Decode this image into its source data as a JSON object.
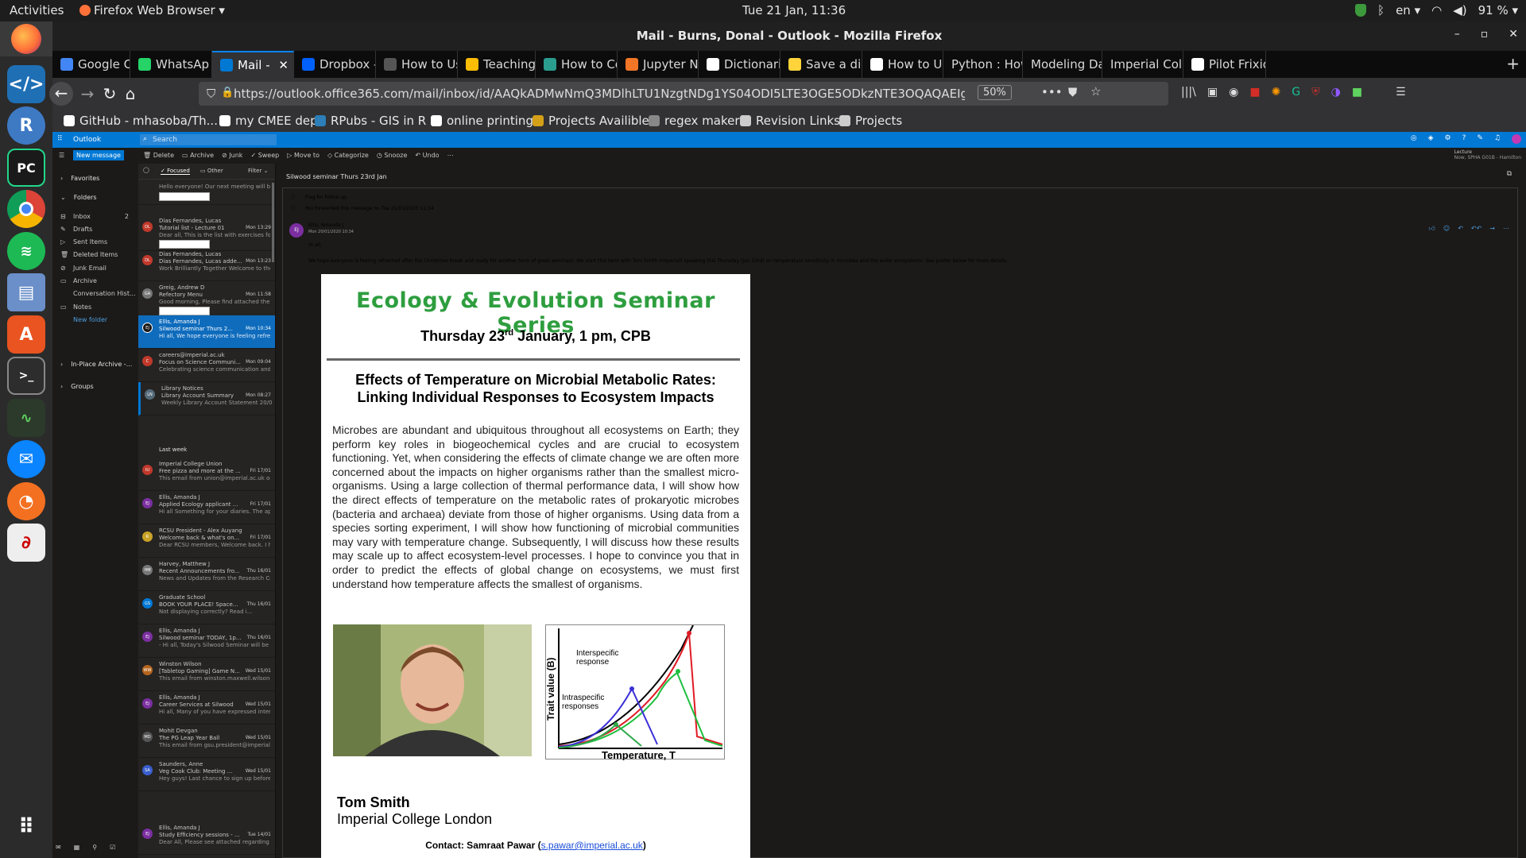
{
  "system_bar": {
    "activities": "Activities",
    "app_menu": "Firefox Web Browser ▾",
    "clock": "Tue 21 Jan, 11:36",
    "language": "en ▾",
    "battery": "91 % ▾"
  },
  "window": {
    "title": "Mail - Burns, Donal - Outlook - Mozilla Firefox"
  },
  "tabs": [
    {
      "label": "Google Cale",
      "color": "#4285f4"
    },
    {
      "label": "WhatsAp",
      "color": "#25d366"
    },
    {
      "label": "Mail - ",
      "color": "#0078d4"
    },
    {
      "label": "Dropbox - l",
      "color": "#0061ff"
    },
    {
      "label": "How to Use",
      "color": "#555555"
    },
    {
      "label": "TeachingVic",
      "color": "#fbbc04"
    },
    {
      "label": "How to Con",
      "color": "#2a9d8f"
    },
    {
      "label": "Jupyter Not",
      "color": "#f37626"
    },
    {
      "label": "Dictionaries",
      "color": "#ffffff"
    },
    {
      "label": "Save a dictic",
      "color": "#ffd43b"
    },
    {
      "label": "How to Use",
      "color": "#ffffff"
    },
    {
      "label": "Python : How t",
      "color": ""
    },
    {
      "label": "Modeling Data",
      "color": ""
    },
    {
      "label": "Imperial Colleg",
      "color": ""
    },
    {
      "label": "Pilot Frixion",
      "color": "#ffffff"
    }
  ],
  "navbar": {
    "url": "https://outlook.office365.com/mail/inbox/id/AAQkADMwNmQ3MDlhLTU1NzgtNDg1YS04ODI5LTE3OGE5ODkzNTE3OQAQAEIgznmVi9VE",
    "zoom": "50%"
  },
  "bookmarks": [
    {
      "label": "GitHub - mhasoba/Th...",
      "color": "#ffffff"
    },
    {
      "label": "my CMEE depo",
      "color": "#ffffff"
    },
    {
      "label": "RPubs - GIS in R",
      "color": "#2c7fb8"
    },
    {
      "label": "online printing",
      "color": "#ffffff"
    },
    {
      "label": "Projects Availible",
      "color": "#d4a017"
    },
    {
      "label": "regex maker",
      "color": "#888888"
    },
    {
      "label": "Revision Links",
      "color": "#cccccc"
    },
    {
      "label": "Projects",
      "color": "#cccccc"
    }
  ],
  "owa": {
    "app_name": "Outlook",
    "search_placeholder": "Search",
    "new_message": "New message",
    "commands": [
      "Delete",
      "Archive",
      "Junk",
      "Sweep",
      "Move to",
      "Categorize",
      "Snooze",
      "Undo"
    ],
    "reminder": "Lecture",
    "reminder_detail": "Now, SPHA G01B - Hamilton"
  },
  "leftnav": {
    "favorites": "Favorites",
    "folders": "Folders",
    "items": [
      {
        "label": "Inbox",
        "count": "2"
      },
      {
        "label": "Drafts",
        "count": ""
      },
      {
        "label": "Sent Items",
        "count": ""
      },
      {
        "label": "Deleted Items",
        "count": ""
      },
      {
        "label": "Junk Email",
        "count": ""
      },
      {
        "label": "Archive",
        "count": ""
      },
      {
        "label": "Conversation Hist...",
        "count": ""
      },
      {
        "label": "Notes",
        "count": ""
      },
      {
        "label": "New folder",
        "count": ""
      }
    ],
    "in_place_archive": "In-Place Archive -...",
    "groups": "Groups"
  },
  "maillist": {
    "focused": "Focused",
    "other": "Other",
    "filter": "Filter",
    "last_week": "Last week",
    "messages": [
      {
        "from": "",
        "subject": "",
        "date": "",
        "preview": "Hello everyone! Our next meeting will be o...",
        "avatar": "",
        "color": "#555555"
      },
      {
        "from": "Dias Fernandes, Lucas",
        "subject": "Tutorial list - Lecture 01",
        "date": "Mon 13:29",
        "preview": "Dear all, This is the list with exercises for M...",
        "avatar": "DL",
        "color": "#c0392b"
      },
      {
        "from": "Dias Fernandes, Lucas",
        "subject": "Dias Fernandes, Lucas adde...",
        "date": "Mon 13:23",
        "preview": "Work Brilliantly Together Welcome to the S...",
        "avatar": "DL",
        "color": "#c0392b"
      },
      {
        "from": "Greig, Andrew D",
        "subject": "Refectory Menu",
        "date": "Mon 11:58",
        "preview": "Good morning, Please find attached the Re...",
        "avatar": "GA",
        "color": "#777777"
      },
      {
        "from": "Ellis, Amanda J",
        "subject": "Silwood seminar Thurs 2...",
        "date": "Mon 10:34",
        "preview": "Hi all, We hope everyone is feeling refresh...",
        "avatar": "EJ",
        "color": "#1b1a19"
      },
      {
        "from": "careers@imperial.ac.uk",
        "subject": "Focus on Science Communi...",
        "date": "Mon 09:04",
        "preview": "Celebrating science communication and p...",
        "avatar": "C",
        "color": "#c0392b"
      },
      {
        "from": "Library Notices",
        "subject": "Library Account Summary",
        "date": "Mon 08:27",
        "preview": "Weekly Library Account Statement 20/01/2...",
        "avatar": "LN",
        "color": "#556b7a"
      },
      {
        "from": "Imperial College Union",
        "subject": "Free pizza and more at the ...",
        "date": "Fri 17/01",
        "preview": "This email from union@imperial.ac.uk origi...",
        "avatar": "IU",
        "color": "#c0392b"
      },
      {
        "from": "Ellis, Amanda J",
        "subject": "Applied Ecology applicant ...",
        "date": "Fri 17/01",
        "preview": "Hi all Something for your diaries. The appli...",
        "avatar": "EJ",
        "color": "#7b2fa0"
      },
      {
        "from": "RCSU President - Alex Auyang",
        "subject": "Welcome back & what's on...",
        "date": "Fri 17/01",
        "preview": "Dear RCSU members, Welcome back. I hop...",
        "avatar": "R",
        "color": "#c9a227"
      },
      {
        "from": "Harvey, Matthew J",
        "subject": "Recent Announcements fro...",
        "date": "Thu 16/01",
        "preview": "News and Updates from the Research Com...",
        "avatar": "HM",
        "color": "#777777"
      },
      {
        "from": "Graduate School",
        "subject": "BOOK YOUR PLACE! Space...",
        "date": "Thu 16/01",
        "preview": "Not displaying correctly? Read i...",
        "avatar": "GS",
        "color": "#0078d4"
      },
      {
        "from": "Ellis, Amanda J",
        "subject": "Silwood seminar TODAY, 1p...",
        "date": "Thu 16/01",
        "preview": "- Hi all, Today's Silwood Seminar will be giv...",
        "avatar": "EJ",
        "color": "#7b2fa0"
      },
      {
        "from": "Winston Wilson",
        "subject": "[Tabletop Gaming] Game N...",
        "date": "Wed 15/01",
        "preview": "This email from winston.maxwell.wilson@...",
        "avatar": "WW",
        "color": "#b5651d"
      },
      {
        "from": "Ellis, Amanda J",
        "subject": "Career Services at Silwood",
        "date": "Wed 15/01",
        "preview": "Hi all, Many of you have expressed interest...",
        "avatar": "EJ",
        "color": "#7b2fa0"
      },
      {
        "from": "Mohit Devgan",
        "subject": "The PG Leap Year Ball",
        "date": "Wed 15/01",
        "preview": "This email from gsu.president@imperial.ac...",
        "avatar": "MD",
        "color": "#555555"
      },
      {
        "from": "Saunders, Anne",
        "subject": "Veg Cook Club: Meeting ...",
        "date": "Wed 15/01",
        "preview": "Hey guys! Last chance to sign up before 4p...",
        "avatar": "SA",
        "color": "#3a5fcd"
      },
      {
        "from": "Ellis, Amanda J",
        "subject": "Study Efficiency sessions - ...",
        "date": "Tue 14/01",
        "preview": "Dear All, Please see attached regarding Stu...",
        "avatar": "EJ",
        "color": "#7b2fa0"
      }
    ]
  },
  "reading": {
    "subject": "Silwood seminar Thurs 23rd Jan",
    "flag_note": "Flag for follow up.",
    "forward_note": "You forwarded this message on Tue 21/01/2020 11:34",
    "sender": "Ellis, Amanda J",
    "sender_initials": "EJ",
    "sent": "Mon 20/01/2020 10:34",
    "greeting": "Hi all,",
    "body": "We hope everyone is feeling refreshed after the Christmas break and ready for another term of great seminars. We start this term with Tom Smith (Imperial) speaking this Thursday (Jan 23rd) on temperature sensitivity in microbes and the wider ecosystems. See poster below for more details."
  },
  "poster": {
    "series": "Ecology & Evolution Seminar Series",
    "date_pre": "Thursday 23",
    "date_sup": "rd",
    "date_post": " January, 1 pm, CPB",
    "talk_title_1": "Effects of Temperature on Microbial Metabolic Rates:",
    "talk_title_2": "Linking Individual Responses to Ecosystem Impacts",
    "abstract": "Microbes are abundant and ubiquitous throughout all ecosystems on Earth; they perform key roles in biogeochemical cycles and are crucial to ecosystem functioning. Yet, when considering the effects of climate change we are often more concerned about the impacts on higher organisms rather than the smallest micro-organisms. Using a large collection of thermal performance data, I will show how the direct effects of temperature on the metabolic rates of prokaryotic microbes (bacteria and archaea) deviate from those of higher organisms. Using data from a species sorting experiment, I will show how functioning of microbial communities may vary with temperature change. Subsequently, I will discuss how these results may scale up to affect ecosystem-level processes. I hope to convince you that in order to predict the effects of global change on ecosystems, we must first understand how temperature affects the smallest of organisms.",
    "graph_ylabel": "Trait value (B)",
    "graph_xlabel": "Temperature, T",
    "graph_label_inter": "Interspecific",
    "graph_label_inter2": "response",
    "graph_label_intra": "Intraspecific",
    "graph_label_intra2": "responses",
    "speaker_name": "Tom Smith",
    "speaker_affil": "Imperial College London",
    "contact_label": "Contact: Samraat Pawar (",
    "contact_email": "s.pawar@imperial.ac.uk",
    "contact_end": ")"
  }
}
